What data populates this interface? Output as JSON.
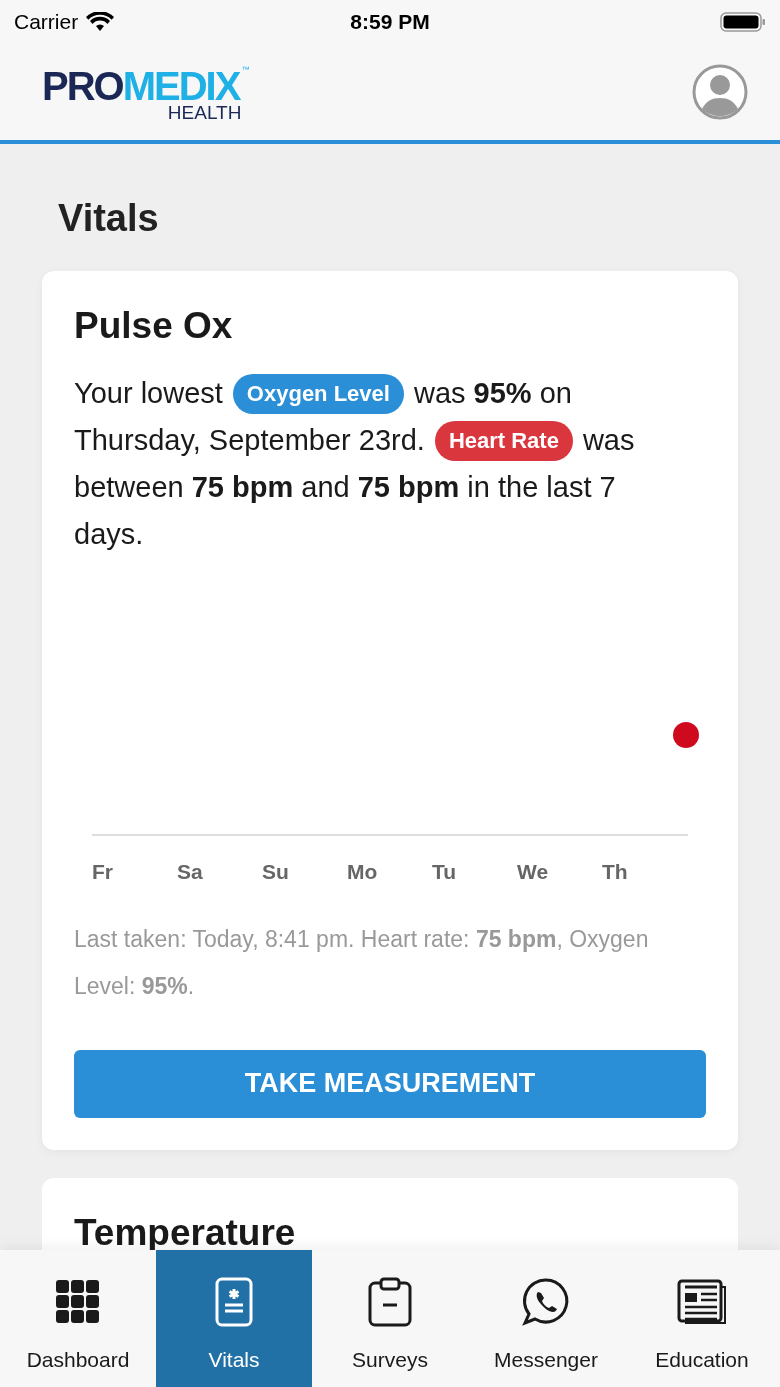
{
  "status_bar": {
    "carrier": "Carrier",
    "time": "8:59 PM"
  },
  "logo": {
    "first": "PRO",
    "second": "MEDIX",
    "tm": "™",
    "sub": "HEALTH"
  },
  "page_title": "Vitals",
  "cards": [
    {
      "title": "Pulse Ox",
      "summary_lines": [
        [
          {
            "kind": "text",
            "text": "Your lowest"
          },
          {
            "kind": "badge",
            "text": "Oxygen Level",
            "color": "#2a8fd6"
          },
          {
            "kind": "text",
            "text": "was **95%** on"
          }
        ],
        [
          {
            "kind": "text",
            "text": "Thursday, September 23rd."
          },
          {
            "kind": "badge",
            "text": "Heart Rate",
            "color": "#d9363e"
          },
          {
            "kind": "text",
            "text": "was"
          }
        ],
        [
          {
            "kind": "text",
            "text": "between **75 bpm** and **75 bpm** in the last 7"
          }
        ],
        [
          {
            "kind": "text",
            "text": "days."
          }
        ]
      ],
      "days": [
        "Fr",
        "Sa",
        "Su",
        "Mo",
        "Tu",
        "We",
        "Th"
      ],
      "last_taken": "Last taken: Today, 8:41 pm. Heart rate: **75 bpm**, Oxygen Level: **95%**.",
      "button": "TAKE MEASUREMENT"
    },
    {
      "title": "Temperature"
    }
  ],
  "tabs": [
    {
      "label": "Dashboard",
      "selected": false
    },
    {
      "label": "Vitals",
      "selected": true
    },
    {
      "label": "Surveys",
      "selected": false
    },
    {
      "label": "Messenger",
      "selected": false
    },
    {
      "label": "Education",
      "selected": false
    }
  ]
}
